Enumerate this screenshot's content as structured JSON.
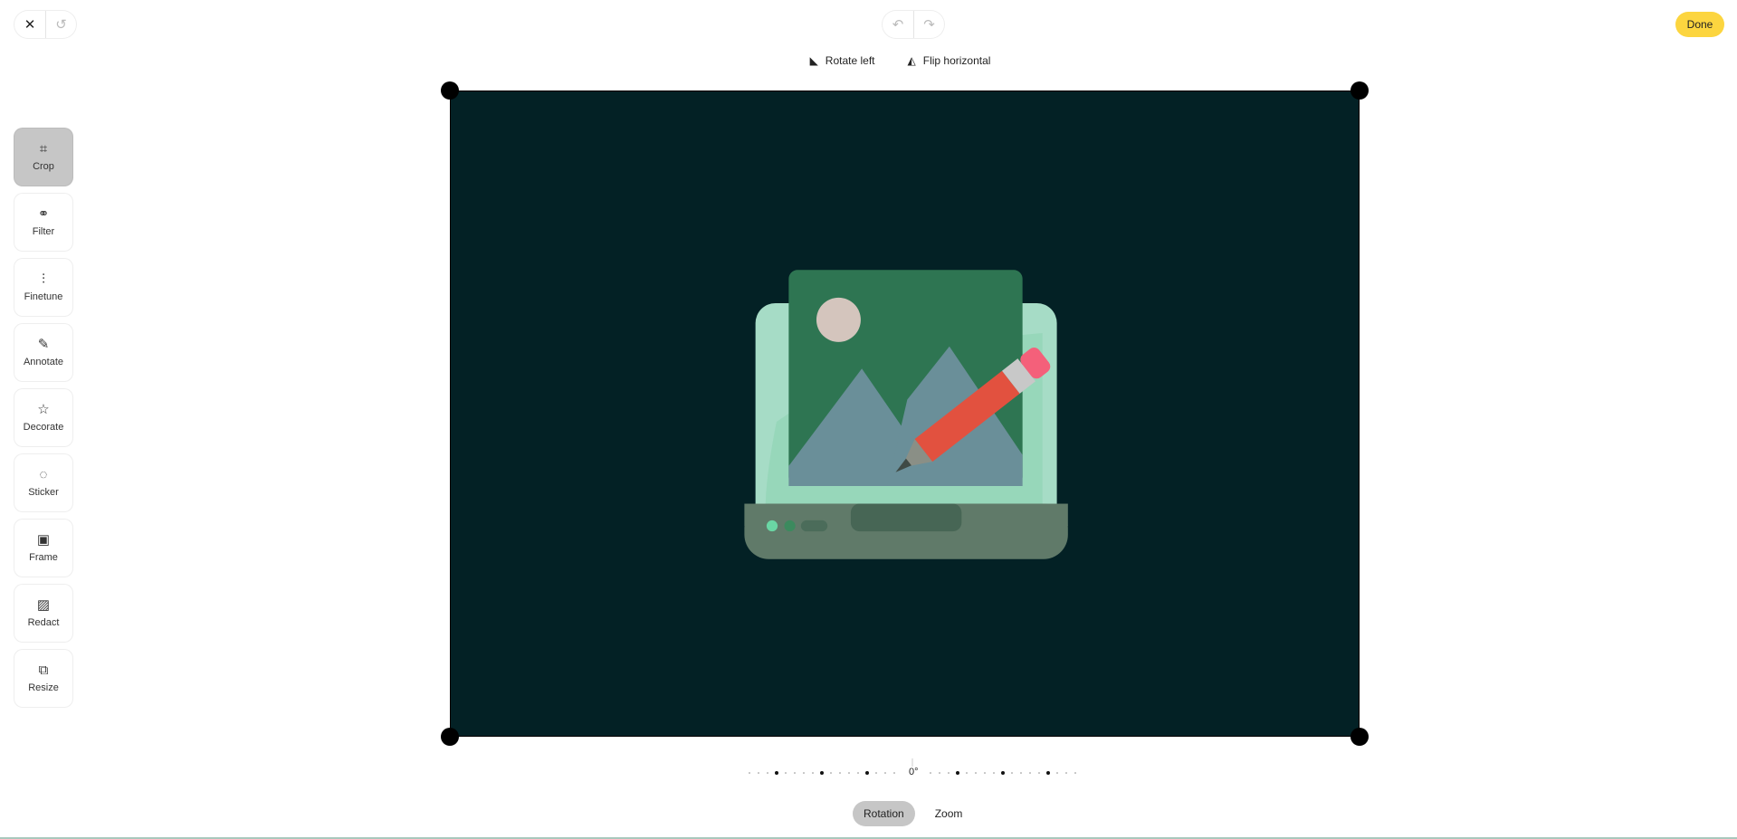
{
  "header": {
    "close_icon": "close-icon",
    "revert_icon": "history-icon",
    "undo_icon": "undo-icon",
    "redo_icon": "redo-icon",
    "done_label": "Done",
    "done_color": "#fcd53f"
  },
  "actions": {
    "rotate_left": "Rotate left",
    "flip_horizontal": "Flip horizontal"
  },
  "tools": [
    {
      "label": "Crop",
      "icon": "crop-icon",
      "glyph": "⌗",
      "active": true
    },
    {
      "label": "Filter",
      "icon": "filter-icon",
      "glyph": "⚭"
    },
    {
      "label": "Finetune",
      "icon": "sliders-icon",
      "glyph": "⫶"
    },
    {
      "label": "Annotate",
      "icon": "pencil-icon",
      "glyph": "✎"
    },
    {
      "label": "Decorate",
      "icon": "star-icon",
      "glyph": "☆"
    },
    {
      "label": "Sticker",
      "icon": "sticker-icon",
      "glyph": "◌"
    },
    {
      "label": "Frame",
      "icon": "frame-icon",
      "glyph": "▣"
    },
    {
      "label": "Redact",
      "icon": "redact-icon",
      "glyph": "▨"
    },
    {
      "label": "Resize",
      "icon": "resize-icon",
      "glyph": "⧉"
    }
  ],
  "rotation": {
    "value_label": "0°",
    "degrees": 0
  },
  "tabs": [
    {
      "label": "Rotation",
      "active": true
    },
    {
      "label": "Zoom"
    }
  ],
  "canvas_color": "#032125"
}
